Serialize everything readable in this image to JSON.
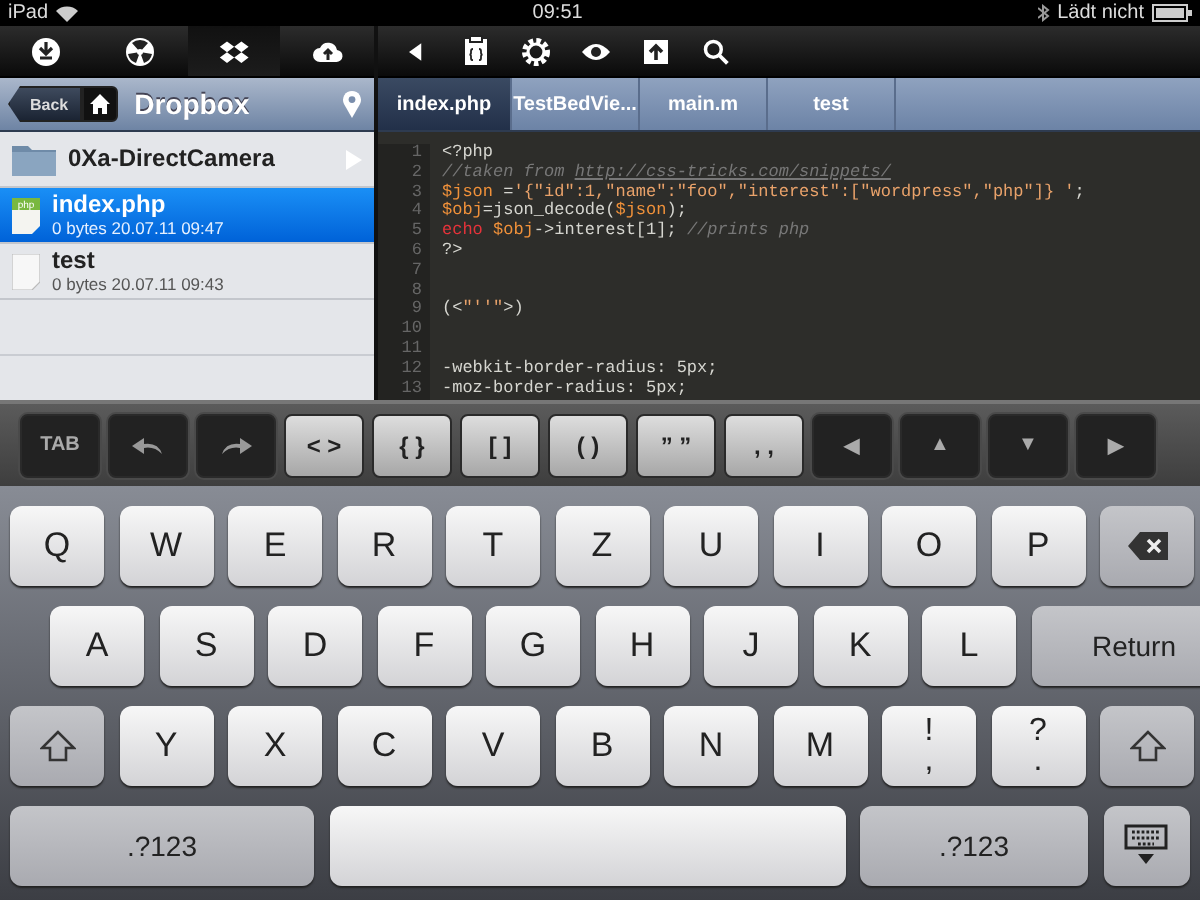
{
  "status_bar": {
    "device": "iPad",
    "time": "09:51",
    "battery_text": "Lädt nicht"
  },
  "toolbar_left": [
    {
      "kind": "download",
      "selected": false
    },
    {
      "kind": "radiation",
      "selected": false
    },
    {
      "kind": "dropbox",
      "selected": true
    },
    {
      "kind": "cloud-upload",
      "selected": false
    }
  ],
  "toolbar_right": [
    {
      "kind": "back"
    },
    {
      "kind": "clipboard"
    },
    {
      "kind": "settings"
    },
    {
      "kind": "eye"
    },
    {
      "kind": "share"
    },
    {
      "kind": "search"
    }
  ],
  "sidebar": {
    "back_label": "Back",
    "title": "Dropbox",
    "items": [
      {
        "kind": "folder",
        "name": "0Xa-DirectCamera",
        "selected": false
      },
      {
        "kind": "php",
        "name": "index.php",
        "meta": "0 bytes 20.07.11 09:47",
        "selected": true
      },
      {
        "kind": "file",
        "name": "test",
        "meta": "0 bytes 20.07.11 09:43",
        "selected": false
      }
    ]
  },
  "editor": {
    "tabs": [
      {
        "label": "index.php",
        "selected": true
      },
      {
        "label": "TestBedVie...",
        "selected": false
      },
      {
        "label": "main.m",
        "selected": false
      },
      {
        "label": "test",
        "selected": false
      }
    ],
    "lines": [
      {
        "number": "1",
        "tokens": [
          {
            "kind": "plain",
            "text": "<?php"
          }
        ]
      },
      {
        "number": "2",
        "tokens": [
          {
            "kind": "comment",
            "text": "//taken from "
          },
          {
            "kind": "link",
            "text": "http://css-tricks.com/snippets/"
          }
        ]
      },
      {
        "number": "3",
        "tokens": [
          {
            "kind": "var",
            "text": "$json"
          },
          {
            "kind": "plain",
            "text": " ="
          },
          {
            "kind": "string",
            "text": "'{\"id\":1,\"name\":\"foo\",\"interest\":[\"wordpress\",\"php\"]} '"
          },
          {
            "kind": "plain",
            "text": ";"
          }
        ]
      },
      {
        "number": "4",
        "tokens": [
          {
            "kind": "var",
            "text": "$obj"
          },
          {
            "kind": "plain",
            "text": "=json_decode("
          },
          {
            "kind": "var",
            "text": "$json"
          },
          {
            "kind": "plain",
            "text": ");"
          }
        ]
      },
      {
        "number": "5",
        "tokens": [
          {
            "kind": "keyword",
            "text": "echo"
          },
          {
            "kind": "var",
            "text": " $obj"
          },
          {
            "kind": "plain",
            "text": "->interest[1]; "
          },
          {
            "kind": "comment",
            "text": "//prints php"
          }
        ]
      },
      {
        "number": "6",
        "tokens": [
          {
            "kind": "plain",
            "text": "?>"
          }
        ]
      },
      {
        "number": "7"
      },
      {
        "number": "8"
      },
      {
        "number": "9",
        "tokens": [
          {
            "kind": "plain",
            "text": "(<"
          },
          {
            "kind": "string",
            "text": "\"''\""
          },
          {
            "kind": "plain",
            "text": ">)"
          }
        ]
      },
      {
        "number": "10"
      },
      {
        "number": "11"
      },
      {
        "number": "12",
        "tokens": [
          {
            "kind": "plain",
            "text": "-webkit-border-radius: 5px;"
          }
        ]
      },
      {
        "number": "13",
        "tokens": [
          {
            "kind": "plain",
            "text": "-moz-border-radius: 5px;"
          }
        ]
      }
    ]
  },
  "accessory_keys": [
    {
      "kind": "dark",
      "label": "TAB"
    },
    {
      "kind": "undo"
    },
    {
      "kind": "redo"
    },
    {
      "kind": "light",
      "label": "< >"
    },
    {
      "kind": "light",
      "label": "{ }"
    },
    {
      "kind": "light",
      "label": "[ ]"
    },
    {
      "kind": "light",
      "label": "( )"
    },
    {
      "kind": "light",
      "label": "” ”"
    },
    {
      "kind": "light",
      "label": ", ,"
    },
    {
      "kind": "dark",
      "label": "◀"
    },
    {
      "kind": "dark",
      "label": "▲"
    },
    {
      "kind": "dark",
      "label": "▼"
    },
    {
      "kind": "dark",
      "label": "▶"
    }
  ],
  "keyboard": {
    "rows": [
      {
        "keys": [
          {
            "kind": "char",
            "label": "Q"
          },
          {
            "kind": "char",
            "label": "W"
          },
          {
            "kind": "char",
            "label": "E"
          },
          {
            "kind": "char",
            "label": "R"
          },
          {
            "kind": "char",
            "label": "T"
          },
          {
            "kind": "char",
            "label": "Z"
          },
          {
            "kind": "char",
            "label": "U"
          },
          {
            "kind": "char",
            "label": "I"
          },
          {
            "kind": "char",
            "label": "O"
          },
          {
            "kind": "char",
            "label": "P"
          },
          {
            "kind": "backspace"
          }
        ]
      },
      {
        "keys": [
          {
            "kind": "char",
            "label": "A"
          },
          {
            "kind": "char",
            "label": "S"
          },
          {
            "kind": "char",
            "label": "D"
          },
          {
            "kind": "char",
            "label": "F"
          },
          {
            "kind": "char",
            "label": "G"
          },
          {
            "kind": "char",
            "label": "H"
          },
          {
            "kind": "char",
            "label": "J"
          },
          {
            "kind": "char",
            "label": "K"
          },
          {
            "kind": "char",
            "label": "L"
          },
          {
            "kind": "return",
            "label": "Return"
          }
        ]
      },
      {
        "keys": [
          {
            "kind": "shift"
          },
          {
            "kind": "char",
            "label": "Y"
          },
          {
            "kind": "char",
            "label": "X"
          },
          {
            "kind": "char",
            "label": "C"
          },
          {
            "kind": "char",
            "label": "V"
          },
          {
            "kind": "char",
            "label": "B"
          },
          {
            "kind": "char",
            "label": "N"
          },
          {
            "kind": "char",
            "label": "M"
          },
          {
            "kind": "dual",
            "label": "!",
            "sub": ","
          },
          {
            "kind": "dual",
            "label": "?",
            "sub": "."
          },
          {
            "kind": "shift"
          }
        ]
      },
      {
        "keys": [
          {
            "kind": "mode",
            "label": ".?123"
          },
          {
            "kind": "space"
          },
          {
            "kind": "mode2",
            "label": ".?123"
          },
          {
            "kind": "hide"
          }
        ]
      }
    ]
  }
}
